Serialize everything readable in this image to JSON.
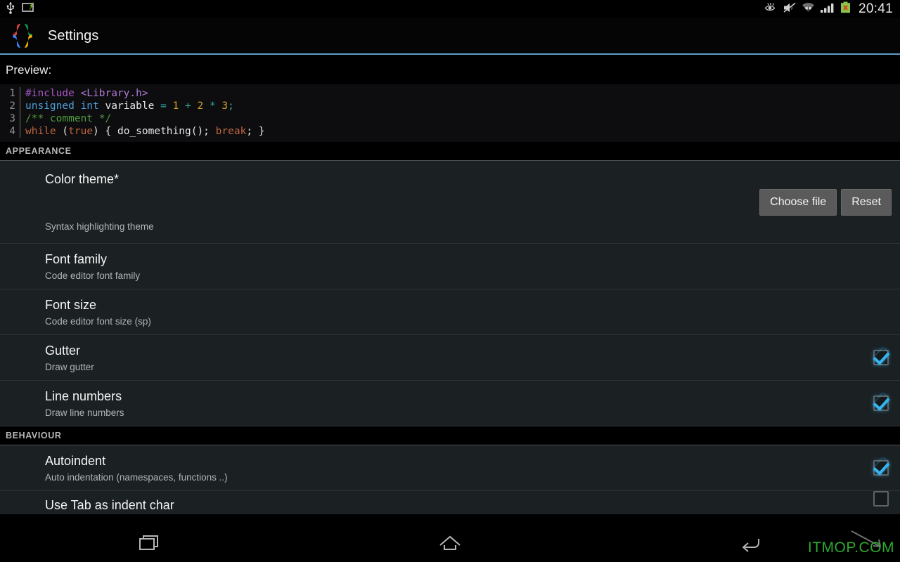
{
  "status_bar": {
    "icons": [
      "usb-icon",
      "screencast-icon"
    ],
    "right_icons": [
      "eye-icon",
      "mute-icon",
      "wifi-icon",
      "signal-icon",
      "battery-error-icon"
    ],
    "clock": "20:41"
  },
  "action_bar": {
    "logo": "braces-logo-icon",
    "title": "Settings",
    "accent": "#5d9cc6"
  },
  "preview": {
    "label": "Preview:",
    "background": "#0d0d0f",
    "lines": [
      {
        "number": "1",
        "tokens": [
          {
            "text": "#include ",
            "color": "#a855c8"
          },
          {
            "text": "<Library.h>",
            "color": "#b07ad4"
          }
        ]
      },
      {
        "number": "2",
        "tokens": [
          {
            "text": "unsigned ",
            "color": "#4b9fd5"
          },
          {
            "text": "int ",
            "color": "#4b9fd5"
          },
          {
            "text": "variable ",
            "color": "#e6e6e6"
          },
          {
            "text": "= ",
            "color": "#2fa8a0"
          },
          {
            "text": "1 ",
            "color": "#c9a227"
          },
          {
            "text": "+ ",
            "color": "#2fa8a0"
          },
          {
            "text": "2 ",
            "color": "#c9a227"
          },
          {
            "text": "* ",
            "color": "#2fa8a0"
          },
          {
            "text": "3",
            "color": "#c9a227"
          },
          {
            "text": ";",
            "color": "#2fa8a0"
          }
        ]
      },
      {
        "number": "3",
        "tokens": [
          {
            "text": "/** comment */",
            "color": "#4e9a3e"
          }
        ]
      },
      {
        "number": "4",
        "tokens": [
          {
            "text": "while ",
            "color": "#c1663f"
          },
          {
            "text": "(",
            "color": "#e6e6e6"
          },
          {
            "text": "true",
            "color": "#c1663f"
          },
          {
            "text": ") { do_something(); ",
            "color": "#e6e6e6"
          },
          {
            "text": "break",
            "color": "#c1663f"
          },
          {
            "text": "; }",
            "color": "#e6e6e6"
          }
        ]
      }
    ]
  },
  "sections": [
    {
      "header": "APPEARANCE",
      "rows": [
        {
          "id": "color-theme",
          "title": "Color theme*",
          "summary": "Syntax highlighting theme",
          "control": "buttons",
          "buttons": [
            {
              "id": "choose-file",
              "label": "Choose file"
            },
            {
              "id": "reset",
              "label": "Reset"
            }
          ]
        },
        {
          "id": "font-family",
          "title": "Font family",
          "summary": "Code editor font family",
          "control": "none"
        },
        {
          "id": "font-size",
          "title": "Font size",
          "summary": "Code editor font size (sp)",
          "control": "none"
        },
        {
          "id": "gutter",
          "title": "Gutter",
          "summary": "Draw gutter",
          "control": "checkbox",
          "checked": true
        },
        {
          "id": "line-numbers",
          "title": "Line numbers",
          "summary": "Draw line numbers",
          "control": "checkbox",
          "checked": true
        }
      ]
    },
    {
      "header": "BEHAVIOUR",
      "rows": [
        {
          "id": "autoindent",
          "title": "Autoindent",
          "summary": "Auto indentation (namespaces, functions ..)",
          "control": "checkbox",
          "checked": true
        },
        {
          "id": "use-tab-as-indent-char",
          "title": "Use Tab as indent char",
          "summary": "",
          "control": "checkbox",
          "checked": false,
          "clipped": true
        }
      ]
    }
  ],
  "nav_bar": {
    "buttons": [
      {
        "id": "recents",
        "icon": "recents-icon"
      },
      {
        "id": "home",
        "icon": "home-icon"
      },
      {
        "id": "back",
        "icon": "back-icon"
      }
    ]
  },
  "watermark": {
    "text": "ITMOP.COM",
    "color": "#2fa82f"
  }
}
